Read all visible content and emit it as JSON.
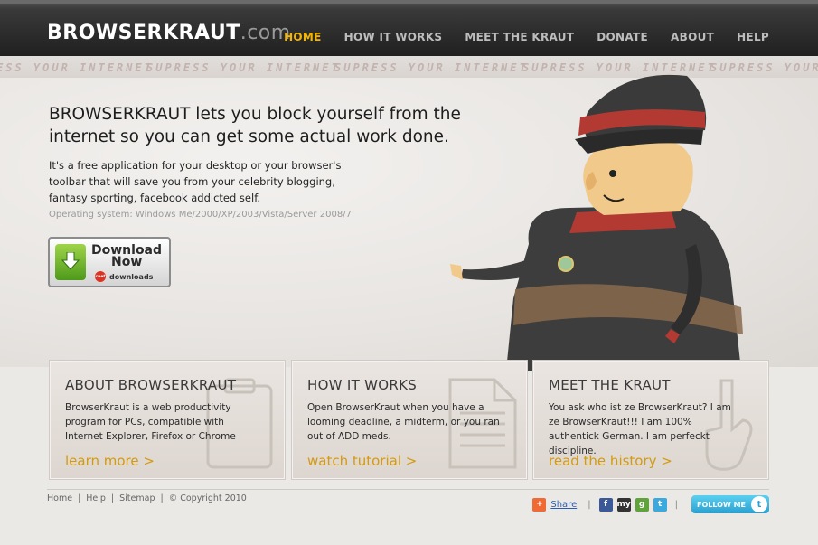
{
  "header": {
    "logo_main": "BROWSERKRAUT",
    "logo_domain": ".com",
    "nav": [
      "HOME",
      "HOW IT WORKS",
      "MEET THE KRAUT",
      "DONATE",
      "ABOUT",
      "HELP"
    ]
  },
  "strip": {
    "slogan": "SUPRESS YOUR INTERNET",
    "slogan_tail": "ESS YOUR INTERNET"
  },
  "hero": {
    "headline": "BROWSERKRAUT lets you block yourself from the internet so you can get some actual work done.",
    "description": "It's a free application for your desktop or your browser's toolbar that will save you from your celebrity blogging, fantasy sporting, facebook addicted self.",
    "os": "Operating system: Windows Me/2000/XP/2003/Vista/Server 2008/7",
    "download": {
      "line1": "Download",
      "line2": "Now",
      "brand": "downloads",
      "brand_logo": "cnet"
    }
  },
  "boxes": [
    {
      "title": "ABOUT BROWSERKRAUT",
      "text": "BrowserKraut is a web productivity program for PCs, compatible with Internet Explorer, Firefox or Chrome",
      "link": "learn more >"
    },
    {
      "title": "HOW IT WORKS",
      "text": "Open BrowserKraut when you have a looming deadline, a midterm, or you ran out of ADD meds.",
      "link": "watch tutorial >"
    },
    {
      "title": "MEET THE KRAUT",
      "text": "You ask who ist ze BrowserKraut? I am ze BrowserKraut!!! I am 100% authentick German. I am perfeckt discipline.",
      "link": "read the history >"
    }
  ],
  "footer": {
    "links": [
      "Home",
      "Help",
      "Sitemap"
    ],
    "copyright": "© Copyright 2010",
    "share": "Share",
    "follow": "FOLLOW ME",
    "separators": [
      "|",
      "|",
      "|"
    ],
    "social_icons": [
      {
        "name": "facebook",
        "glyph": "f",
        "color": "#3b5998"
      },
      {
        "name": "myspace",
        "glyph": "my",
        "color": "#333333"
      },
      {
        "name": "google",
        "glyph": "g",
        "color": "#5fa33a"
      },
      {
        "name": "twitter",
        "glyph": "t",
        "color": "#3aa9dd"
      }
    ]
  },
  "colors": {
    "accent": "#f4b400",
    "link": "#d49a10",
    "topbar": "#1e1e1e",
    "background": "#ebe9e6"
  }
}
